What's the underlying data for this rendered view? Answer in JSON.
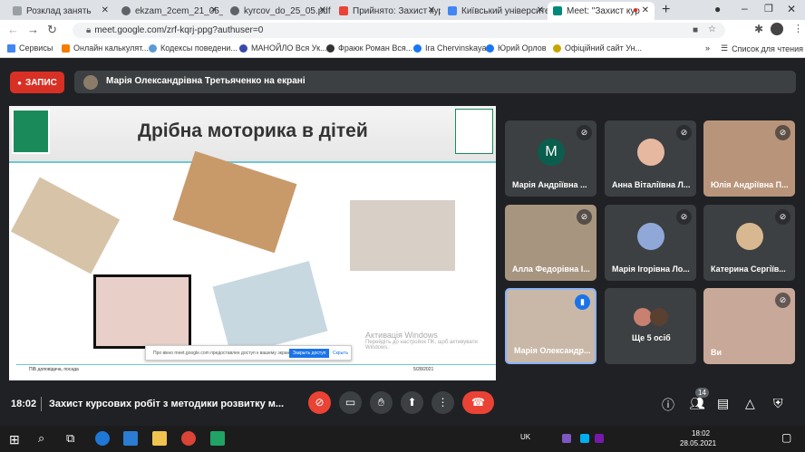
{
  "tabs": [
    {
      "label": "Розклад занять",
      "color": "#9aa0a6"
    },
    {
      "label": "ekzam_2cem_21_05_1",
      "color": "#5f6368"
    },
    {
      "label": "kyrcov_do_25_05.pdf",
      "color": "#5f6368"
    },
    {
      "label": "Прийнято: Захист кур",
      "color": "#ea4335"
    },
    {
      "label": "Київський університе",
      "color": "#4285f4"
    },
    {
      "label": "Meet: \"Захист кур",
      "color": "#00897b"
    }
  ],
  "address": {
    "url": "meet.google.com/zrf-kqrj-ppg?authuser=0"
  },
  "bookmarks": [
    "Сервисы",
    "Онлайн калькулят...",
    "Кодексы поведени...",
    "МАНОЙЛО Вся Ук...",
    "Фраюк Роман Вся...",
    "Ira Chervinskaya",
    "Юрий Орлов",
    "Офіційний сайт Ун..."
  ],
  "reading_list": "Список для чтения",
  "recording_label": "ЗАПИС",
  "presenting": "Марія Олександрівна Третьяченко на екрані",
  "slide": {
    "title": "Дрібна моторика в дітей",
    "footer_left": "ПІБ доповідача, посада",
    "footer_right": "5/28/2021",
    "share_notice": "Про вікно meet.google.com предоставлен доступ к вашему экрану.",
    "stop_share": "Закрыть доступ",
    "hide": "Скрыть",
    "win_activate": "Активація Windows",
    "win_activate_sub": "Перейдіть до настройок ПК, щоб активувати Windows."
  },
  "participants": [
    {
      "name": "Марія Андріївна ...",
      "initial": "M"
    },
    {
      "name": "Анна Віталіївна Л..."
    },
    {
      "name": "Юлія Андріївна П..."
    },
    {
      "name": "Алла Федорівна І..."
    },
    {
      "name": "Марія Ігорівна Ло..."
    },
    {
      "name": "Катерина Сергіїв..."
    },
    {
      "name": "Марія Олександр..."
    },
    {
      "name": "Ще 5 осіб"
    },
    {
      "name": "Ви"
    }
  ],
  "meeting": {
    "time": "18:02",
    "title": "Захист курсових робіт з методики розвитку м...",
    "participant_count": "14"
  },
  "taskbar": {
    "lang": "UK",
    "time": "18:02",
    "date": "28.05.2021"
  }
}
